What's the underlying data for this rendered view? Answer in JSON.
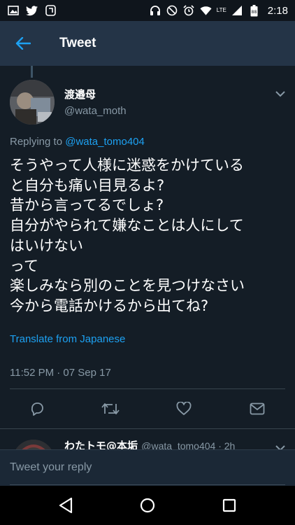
{
  "status_bar": {
    "time": "2:18",
    "network_label": "LTE",
    "left_icons": [
      "image-icon",
      "twitter-icon",
      "sync-icon"
    ],
    "right_icons": [
      "headphones-icon",
      "do-not-disturb-icon",
      "alarm-icon",
      "wifi-icon",
      "signal-icon",
      "battery-icon"
    ]
  },
  "header": {
    "title": "Tweet",
    "back_icon": "arrow-left-icon"
  },
  "tweet": {
    "author_name": "渡邉母",
    "author_handle": "@wata_moth",
    "replying_prefix": "Replying to",
    "replying_handle": "@wata_tomo404",
    "lines": [
      "そうやって人様に迷惑をかけている",
      "と自分も痛い目見るよ?",
      "昔から言ってるでしょ?",
      "自分がやられて嫌なことは人にして",
      "はいけない",
      "って",
      "楽しみなら別のことを見つけなさい",
      "今から電話かけるから出てね?"
    ],
    "translate_label": "Translate from Japanese",
    "timestamp": "11:52 PM · 07 Sep 17",
    "actions": [
      "reply-icon",
      "retweet-icon",
      "like-icon",
      "message-icon"
    ]
  },
  "next_tweet": {
    "author_name": "わたトモ@本垢",
    "meta": "@wata_tomo404 · 2h"
  },
  "reply_box": {
    "placeholder": "Tweet your reply"
  },
  "colors": {
    "background": "#141d26",
    "app_bar": "#243447",
    "accent": "#1da1f2",
    "secondary_text": "#8899a6"
  }
}
